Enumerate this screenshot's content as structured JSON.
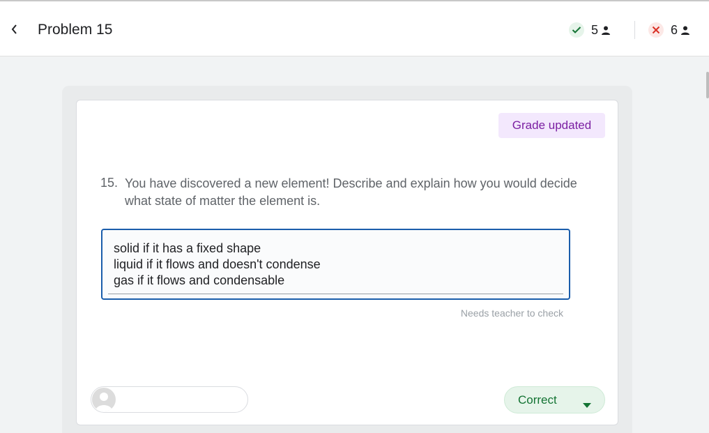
{
  "header": {
    "title": "Problem 15",
    "correct_count": "5",
    "incorrect_count": "6"
  },
  "card": {
    "status_badge": "Grade updated",
    "question_number": "15.",
    "question_text": "You have discovered a new element! Describe and explain how you would decide what state of matter the element is.",
    "answer_lines": [
      "solid if it has a fixed shape",
      "liquid if it flows and doesn't condense",
      "gas if it flows and condensable"
    ],
    "hint": "Needs teacher to check",
    "grade_label": "Correct"
  },
  "icons": {
    "back": "chevron-left-icon",
    "correct": "check-icon",
    "incorrect": "close-icon",
    "person": "person-icon",
    "dropdown": "caret-down-icon"
  },
  "colors": {
    "correct_green": "#137333",
    "incorrect_red": "#d93025",
    "focus_blue": "#1a5dab",
    "badge_purple": "#7b1fa2"
  }
}
